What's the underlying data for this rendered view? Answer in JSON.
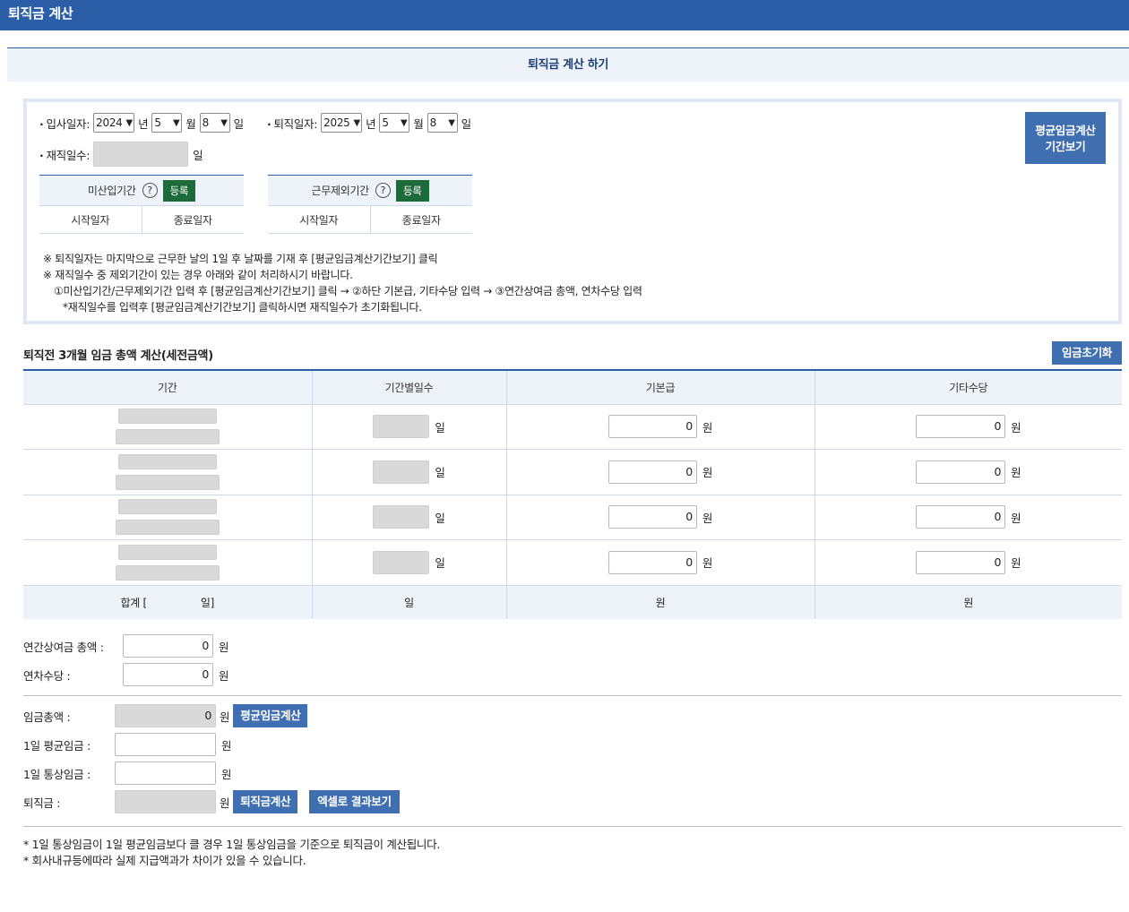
{
  "header": {
    "title": "퇴직금 계산"
  },
  "subheader": {
    "title": "퇴직금 계산 하기"
  },
  "dates": {
    "join_label": "입사일자:",
    "join_year": "2024",
    "join_month": "5",
    "join_day": "8",
    "retire_label": "퇴직일자:",
    "retire_year": "2025",
    "retire_month": "5",
    "retire_day": "8",
    "unit_year": "년",
    "unit_month": "월",
    "unit_day": "일",
    "tenure_label": "재직일수:",
    "tenure_unit": "일"
  },
  "unpaid_period": {
    "label": "미산입기간",
    "help": "?",
    "register": "등록",
    "start": "시작일자",
    "end": "종료일자"
  },
  "excluded_period": {
    "label": "근무제외기간",
    "help": "?",
    "register": "등록",
    "start": "시작일자",
    "end": "종료일자"
  },
  "period_button": {
    "line1": "평균임금계산",
    "line2": "기간보기"
  },
  "notes": {
    "n1": "※ 퇴직일자는 마지막으로 근무한 날의 1일 후 날짜를 기재 후 [평균임금계산기간보기] 클릭",
    "n2": "※ 재직일수 중 제외기간이 있는 경우 아래와 같이 처리하시기 바랍니다.",
    "n3": "①미산입기간/근무제외기간 입력 후 [평균임금계산기간보기] 클릭 → ②하단 기본급, 기타수당 입력 → ③연간상여금 총액, 연차수당 입력",
    "n4": "*재직일수를 입력후 [평균임금계산기간보기] 클릭하시면 재직일수가 초기화됩니다."
  },
  "wage_section": {
    "title": "퇴직전 3개월 임금 총액 계산(세전금액)",
    "reset_button": "임금초기화",
    "columns": [
      "기간",
      "기간별일수",
      "기본급",
      "기타수당"
    ],
    "rows": [
      {
        "base": "0",
        "extra": "0"
      },
      {
        "base": "0",
        "extra": "0"
      },
      {
        "base": "0",
        "extra": "0"
      },
      {
        "base": "0",
        "extra": "0"
      }
    ],
    "unit_day": "일",
    "unit_won": "원",
    "sum_label_left": "합계 [",
    "sum_label_right": "일]",
    "sum_days_unit": "일",
    "sum_base_unit": "원",
    "sum_extra_unit": "원"
  },
  "bonus": {
    "annual_label": "연간상여금 총액 :",
    "annual_value": "0",
    "leave_label": "연차수당 :",
    "leave_value": "0",
    "unit": "원"
  },
  "results": {
    "total_label": "임금총액 :",
    "total_value": "0",
    "avg_button": "평균임금계산",
    "daily_avg_label": "1일 평균임금 :",
    "daily_ordinary_label": "1일 통상임금 :",
    "severance_label": "퇴직금 :",
    "severance_button": "퇴직금계산",
    "excel_button": "엑셀로 결과보기",
    "unit": "원"
  },
  "footnotes": {
    "f1": "* 1일 통상임금이 1일 평균임금보다 클 경우 1일 통상임금을 기준으로 퇴직금이 계산됩니다.",
    "f2": "* 회사내규등에따라 실제 지급액과가 차이가 있을 수 있습니다."
  }
}
